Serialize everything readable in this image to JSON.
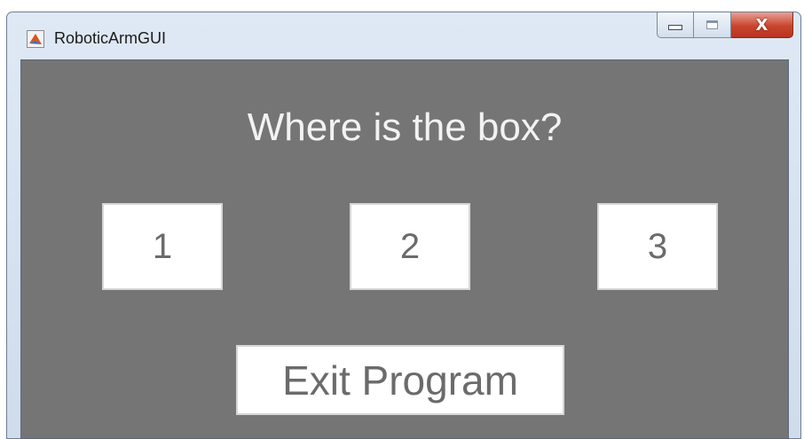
{
  "window": {
    "title": "RoboticArmGUI",
    "icon": "matlab-icon",
    "close_glyph": "X",
    "controls": [
      "minimize-icon",
      "maximize-icon",
      "close-icon"
    ]
  },
  "main": {
    "heading": "Where is the box?",
    "buttons": [
      {
        "label": "1"
      },
      {
        "label": "2"
      },
      {
        "label": "3"
      }
    ],
    "exit_label": "Exit Program"
  },
  "colors": {
    "panel_background": "#757575",
    "button_background": "#ffffff",
    "button_text": "#6b6b6b",
    "heading_text": "#f2f2f2",
    "close_button": "#c9452e"
  }
}
